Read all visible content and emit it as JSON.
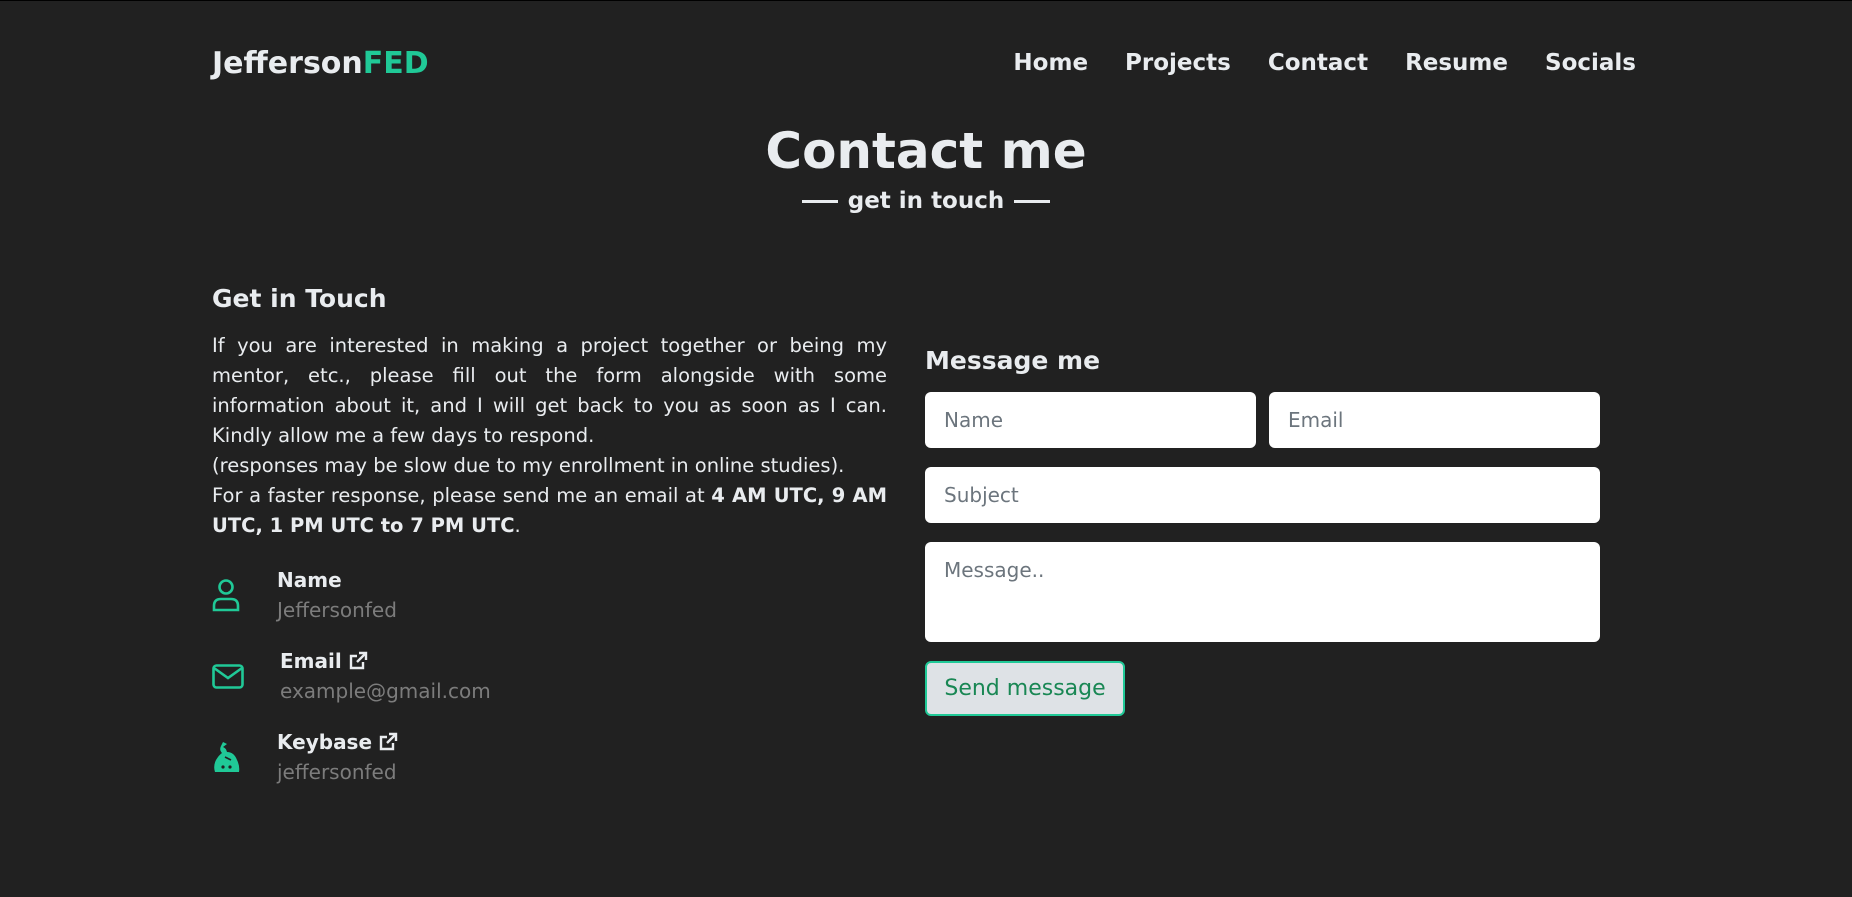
{
  "header": {
    "logo_primary": "Jefferson",
    "logo_accent": "FED",
    "nav": [
      "Home",
      "Projects",
      "Contact",
      "Resume",
      "Socials"
    ]
  },
  "hero": {
    "title": "Contact me",
    "subtitle": "get in touch"
  },
  "about": {
    "heading": "Get in Touch",
    "paragraph_1": "If you are interested in making a project together or being my mentor, etc., please fill out the form alongside with some information about it, and I will get back to you as soon as I can. Kindly allow me a few days to respond.",
    "paragraph_2": "(responses may be slow due to my enrollment in online studies).",
    "paragraph_3_prefix": "For a faster response, please send me an email at ",
    "paragraph_3_times": "4 AM UTC, 9 AM UTC, 1 PM UTC to 7 PM UTC",
    "paragraph_3_suffix": "."
  },
  "info": [
    {
      "label": "Name",
      "value": "Jeffersonfed",
      "icon": "user-icon",
      "external": false
    },
    {
      "label": "Email",
      "value": "example@gmail.com",
      "icon": "envelope-icon",
      "external": true
    },
    {
      "label": "Keybase",
      "value": "jeffersonfed",
      "icon": "keybase-icon",
      "external": true
    }
  ],
  "form": {
    "heading": "Message me",
    "name_placeholder": "Name",
    "email_placeholder": "Email",
    "subject_placeholder": "Subject",
    "message_placeholder": "Message..",
    "submit_label": "Send message"
  },
  "colors": {
    "background": "#212121",
    "accent": "#20c997",
    "text": "#e9ecef",
    "muted": "#7c7c7c"
  }
}
